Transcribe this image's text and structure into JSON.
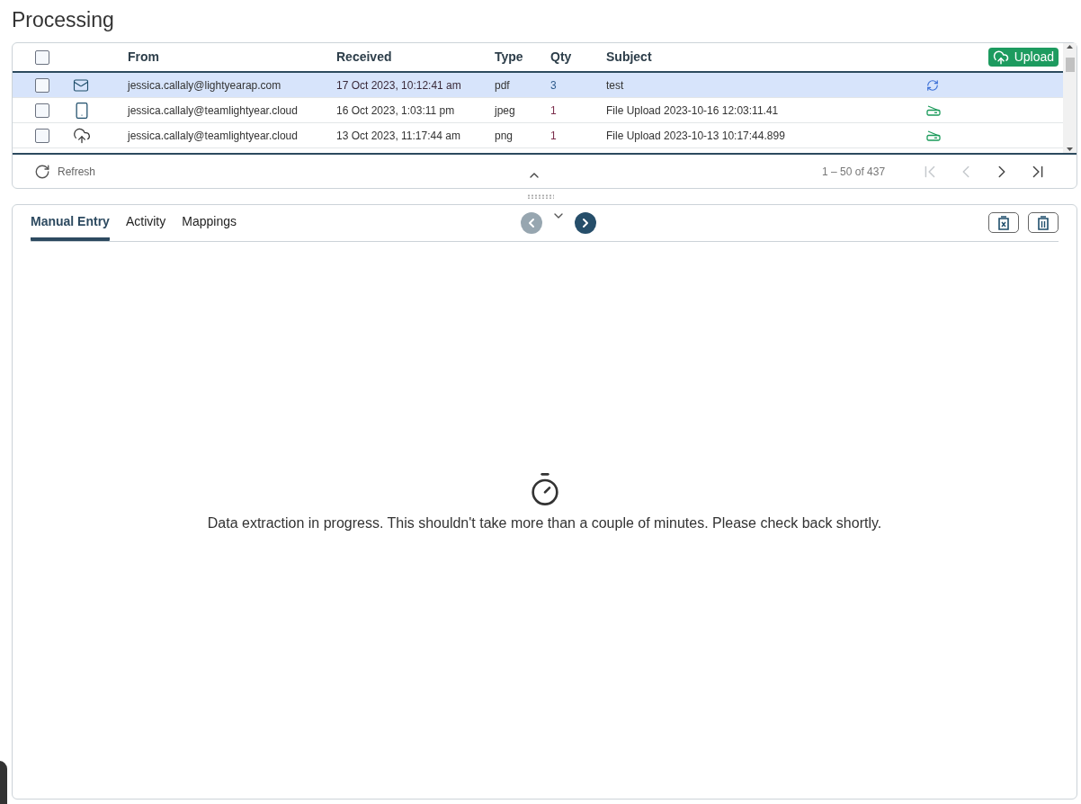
{
  "page_title": "Processing",
  "table": {
    "columns": [
      "From",
      "Received",
      "Type",
      "Qty",
      "Subject"
    ],
    "select_all": {
      "checked": false
    },
    "upload_button": "Upload",
    "rows": [
      {
        "kind": "email",
        "from": "jessica.callaly@lightyearap.com",
        "received": "17 Oct 2023, 10:12:41 am",
        "type": "pdf",
        "qty": "3",
        "subject": "test",
        "status": {
          "kind": "syncing"
        },
        "selected": true,
        "checked": false
      },
      {
        "kind": "phone",
        "from": "jessica.callaly@teamlightyear.cloud",
        "received": "16 Oct 2023, 1:03:11 pm",
        "type": "jpeg",
        "qty": "1",
        "subject": "File Upload 2023-10-16 12:03:11.41",
        "status": {
          "kind": "scanned"
        },
        "selected": false,
        "checked": false
      },
      {
        "kind": "cloud",
        "from": "jessica.callaly@teamlightyear.cloud",
        "received": "13 Oct 2023, 11:17:44 am",
        "type": "png",
        "qty": "1",
        "subject": "File Upload 2023-10-13 10:17:44.899",
        "status": {
          "kind": "scanned"
        },
        "selected": false,
        "checked": false
      }
    ]
  },
  "footer": {
    "refresh": "Refresh",
    "range": "1 – 50 of 437",
    "first": {
      "disabled": true
    },
    "prev": {
      "disabled": true
    },
    "next": {
      "disabled": false
    },
    "last": {
      "disabled": false
    }
  },
  "detail": {
    "tabs": [
      {
        "label": "Manual Entry",
        "selected": true
      },
      {
        "label": "Activity",
        "selected": false
      },
      {
        "label": "Mappings",
        "selected": false
      }
    ],
    "prev_doc": {
      "disabled": true
    },
    "next_doc": {
      "disabled": false
    },
    "message": "Data extraction in progress. This shouldn't take more than a couple of minutes. Please check back shortly."
  }
}
